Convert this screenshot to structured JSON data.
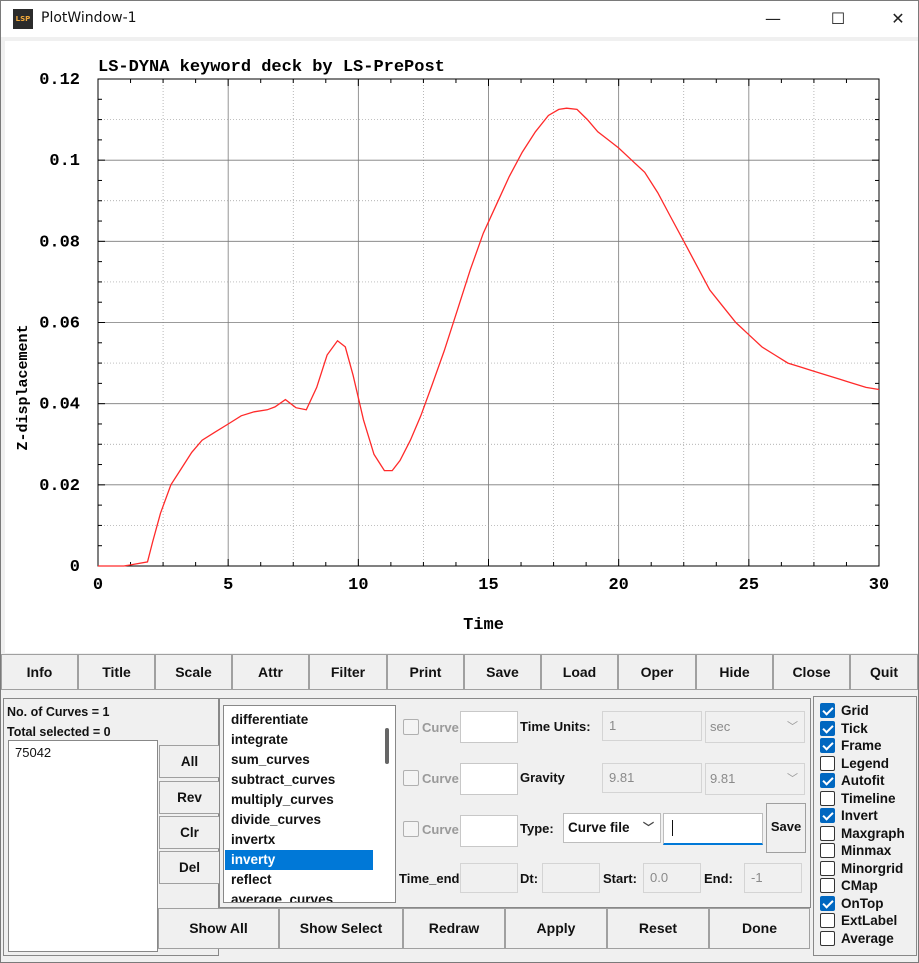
{
  "window": {
    "title": "PlotWindow-1",
    "icon_text": "LSP",
    "controls": {
      "minimize": "—",
      "maximize": "☐",
      "close": "✕"
    }
  },
  "chart_data": {
    "type": "line",
    "title": "LS-DYNA keyword deck by LS-PrePost",
    "xlabel": "Time",
    "ylabel": "Z-displacement",
    "xlim": [
      0,
      30
    ],
    "ylim": [
      0,
      0.12
    ],
    "xticks": [
      "0",
      "5",
      "10",
      "15",
      "20",
      "25",
      "30"
    ],
    "yticks": [
      "0",
      "0.02",
      "0.04",
      "0.06",
      "0.08",
      "0.1",
      "0.12"
    ],
    "grid": true,
    "line_color": "#ff2a2a",
    "series": [
      {
        "x": [
          0,
          1.0,
          1.9,
          2.1,
          2.4,
          2.8,
          3.2,
          3.6,
          4.0,
          4.5,
          5.0,
          5.5,
          6.0,
          6.5,
          6.8,
          7.2,
          7.6,
          8.0,
          8.4,
          8.8,
          9.2,
          9.5,
          9.8,
          10.2,
          10.6,
          11.0,
          11.3,
          11.6,
          12.0,
          12.4,
          12.8,
          13.3,
          13.8,
          14.3,
          14.8,
          15.3,
          15.8,
          16.3,
          16.8,
          17.3,
          17.7,
          18.0,
          18.4,
          18.8,
          19.2,
          19.6,
          20.0,
          20.5,
          21.0,
          21.5,
          22.0,
          22.5,
          23.0,
          23.5,
          24.0,
          24.5,
          25.0,
          25.5,
          26.0,
          26.5,
          27.0,
          27.5,
          28.0,
          28.5,
          29.0,
          29.5,
          30.0
        ],
        "y": [
          0,
          0,
          0.001,
          0.006,
          0.013,
          0.02,
          0.024,
          0.028,
          0.031,
          0.033,
          0.035,
          0.037,
          0.038,
          0.0385,
          0.0392,
          0.041,
          0.039,
          0.0385,
          0.044,
          0.052,
          0.0555,
          0.054,
          0.047,
          0.036,
          0.0275,
          0.0235,
          0.0235,
          0.026,
          0.031,
          0.037,
          0.044,
          0.053,
          0.063,
          0.073,
          0.082,
          0.089,
          0.096,
          0.102,
          0.107,
          0.111,
          0.1125,
          0.1128,
          0.1125,
          0.11,
          0.107,
          0.105,
          0.103,
          0.1,
          0.097,
          0.092,
          0.086,
          0.08,
          0.074,
          0.068,
          0.064,
          0.06,
          0.057,
          0.054,
          0.052,
          0.05,
          0.049,
          0.048,
          0.047,
          0.046,
          0.045,
          0.044,
          0.0435
        ]
      }
    ]
  },
  "toolbar": {
    "buttons": [
      "Info",
      "Title",
      "Scale",
      "Attr",
      "Filter",
      "Print",
      "Save",
      "Load",
      "Oper",
      "Hide",
      "Close",
      "Quit"
    ]
  },
  "left_panel": {
    "num_curves": "No. of Curves = 1",
    "total_selected": "Total selected = 0",
    "curves": [
      "75042"
    ],
    "side_buttons": [
      "All",
      "Rev",
      "Clr",
      "Del"
    ]
  },
  "operations": {
    "items": [
      "differentiate",
      "integrate",
      "sum_curves",
      "subtract_curves",
      "multiply_curves",
      "divide_curves",
      "invertx",
      "inverty",
      "reflect",
      "average_curves"
    ],
    "selected": "inverty"
  },
  "params": {
    "curve_label": "Curve",
    "time_units_label": "Time Units:",
    "time_units_value": "1",
    "time_units_select": "sec",
    "gravity_label": "Gravity",
    "gravity_value": "9.81",
    "gravity_select": "9.81",
    "type_label": "Type:",
    "type_select": "Curve file",
    "file_value": "",
    "save_label": "Save",
    "time_end_label": "Time_end",
    "dt_label": "Dt:",
    "start_label": "Start:",
    "start_value": "0.0",
    "end_label": "End:",
    "end_value": "-1"
  },
  "actions": {
    "buttons": [
      "Show All",
      "Show Select",
      "Redraw",
      "Apply",
      "Reset",
      "Done"
    ]
  },
  "options": [
    {
      "label": "Grid",
      "checked": true
    },
    {
      "label": "Tick",
      "checked": true
    },
    {
      "label": "Frame",
      "checked": true
    },
    {
      "label": "Legend",
      "checked": false
    },
    {
      "label": "Autofit",
      "checked": true
    },
    {
      "label": "Timeline",
      "checked": false
    },
    {
      "label": "Invert",
      "checked": true
    },
    {
      "label": "Maxgraph",
      "checked": false
    },
    {
      "label": "Minmax",
      "checked": false
    },
    {
      "label": "Minorgrid",
      "checked": false
    },
    {
      "label": "CMap",
      "checked": false
    },
    {
      "label": "OnTop",
      "checked": true
    },
    {
      "label": "ExtLabel",
      "checked": false
    },
    {
      "label": "Average",
      "checked": false
    }
  ]
}
